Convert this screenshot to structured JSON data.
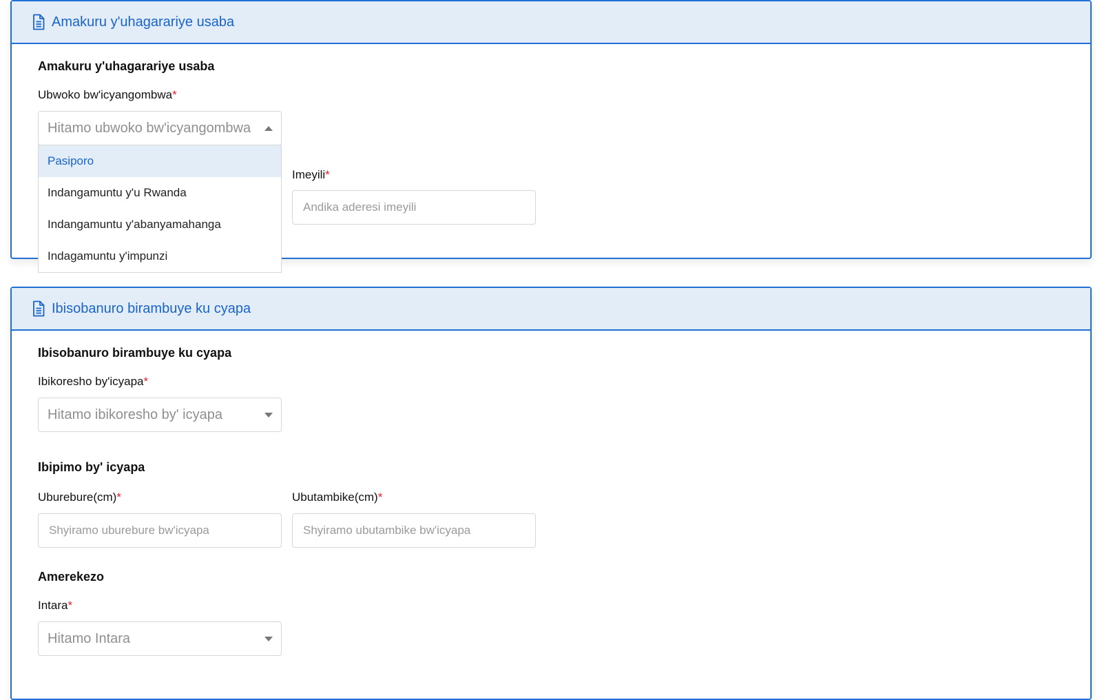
{
  "section1": {
    "header_title": "Amakuru y'uhagarariye usaba",
    "subtitle": "Amakuru y'uhagarariye usaba",
    "id_type": {
      "label": "Ubwoko bw'icyangombwa",
      "required_mark": "*",
      "placeholder": "Hitamo ubwoko bw'icyangombwa",
      "options": [
        "Pasiporo",
        "Indangamuntu y'u Rwanda",
        "Indangamuntu y'abanyamahanga",
        "Indagamuntu y'impunzi"
      ],
      "highlighted_option": "Pasiporo"
    },
    "email": {
      "label": "Imeyili",
      "required_mark": "*",
      "placeholder": "Andika aderesi imeyili"
    }
  },
  "section2": {
    "header_title": "Ibisobanuro birambuye ku cyapa",
    "subtitle": "Ibisobanuro birambuye ku cyapa",
    "materials": {
      "label": "Ibikoresho by'icyapa",
      "required_mark": "*",
      "placeholder": "Hitamo ibikoresho by' icyapa"
    },
    "dimensions_title": "Ibipimo by' icyapa",
    "length": {
      "label": "Uburebure(cm)",
      "required_mark": "*",
      "placeholder": "Shyiramo uburebure bw'icyapa"
    },
    "width": {
      "label": "Ubutambike(cm)",
      "required_mark": "*",
      "placeholder": "Shyiramo ubutambike bw'icyapa"
    },
    "location_title": "Amerekezo",
    "province": {
      "label": "Intara",
      "required_mark": "*",
      "placeholder": "Hitamo Intara"
    }
  },
  "colors": {
    "accent": "#1f6fd6",
    "header_bg": "#e2edf8",
    "required": "#e5202a"
  },
  "icons": {
    "header_icon": "document-icon"
  }
}
